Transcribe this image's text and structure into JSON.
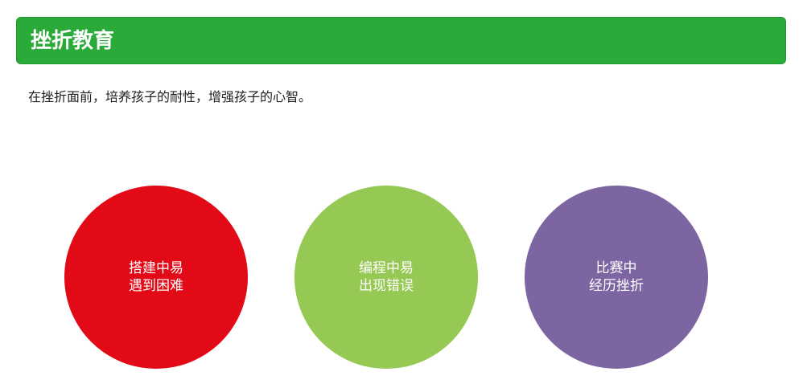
{
  "header": {
    "title": "挫折教育",
    "color": "#2aaa38"
  },
  "intro": {
    "text": "在挫折面前，培养孩子的耐性，增强孩子的心智。"
  },
  "circles": [
    {
      "line1": "搭建中易",
      "line2": "遇到困难",
      "color": "#e20a16"
    },
    {
      "line1": "编程中易",
      "line2": "出现错误",
      "color": "#96c854"
    },
    {
      "line1": "比赛中",
      "line2": "经历挫折",
      "color": "#7d65a1"
    }
  ]
}
